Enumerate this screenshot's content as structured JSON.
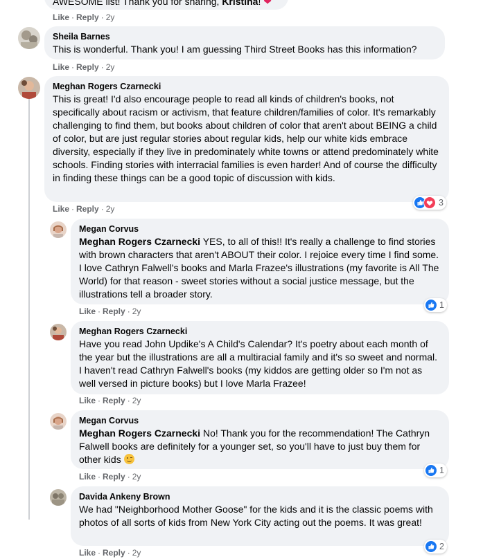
{
  "comments": [
    {
      "partial_text_prefix": "AWESOME list! Thank you for sharing, ",
      "partial_mention": "Kristina",
      "partial_text_suffix": "! ",
      "emoji": "red-heart",
      "like": "Like",
      "reply": "Reply",
      "time": "2y"
    },
    {
      "author": "Sheila Barnes",
      "text": "This is wonderful. Thank you! I am guessing Third Street Books has this information?",
      "like": "Like",
      "reply": "Reply",
      "time": "2y"
    },
    {
      "author": "Meghan Rogers Czarnecki",
      "text": "This is great! I'd also encourage people to read all kinds of children's books, not specifically about racism or activism, that feature children/families of color. It's remarkably challenging to find them, but books about children of color that aren't about BEING a child of color, but are just regular stories about regular kids, help our white kids embrace diversity, especially if they live in predominately white towns or attend predominately white schools. Finding stories with interracial families is even harder! And of course the difficulty in finding these things can be a good topic of discussion with kids.",
      "like": "Like",
      "reply": "Reply",
      "time": "2y",
      "reactions": [
        "like",
        "love"
      ],
      "reaction_count": "3"
    },
    {
      "author": "Megan Corvus",
      "mention": "Meghan Rogers Czarnecki",
      "text": " YES, to all of this!! It's really a challenge to find stories with brown characters that aren't ABOUT their color. I rejoice every time I find some. I love Cathryn Falwell's books and Marla Frazee's illustrations (my favorite is All The World) for that reason - sweet stories without a social justice message, but the illustrations tell a broader story.",
      "like": "Like",
      "reply": "Reply",
      "time": "2y",
      "reactions": [
        "like"
      ],
      "reaction_count": "1"
    },
    {
      "author": "Meghan Rogers Czarnecki",
      "text": "Have you read John Updike's A Child's Calendar? It's poetry about each month of the year but the illustrations are all a multiracial family and it's so sweet and normal. I haven't read Cathryn Falwell's books (my kiddos are getting older so I'm not as well versed in picture books) but I love Marla Frazee!",
      "like": "Like",
      "reply": "Reply",
      "time": "2y"
    },
    {
      "author": "Megan Corvus",
      "mention": "Meghan Rogers Czarnecki",
      "text": " No! Thank you for the recommendation! The Cathryn Falwell books are definitely for a younger set, so you'll have to just buy them for other kids ",
      "emoji": "winking-face",
      "like": "Like",
      "reply": "Reply",
      "time": "2y",
      "reactions": [
        "like"
      ],
      "reaction_count": "1"
    },
    {
      "author": "Davida Ankeny Brown",
      "text": "We had \"Neighborhood Mother Goose\" for the kids and it is the classic poems with photos of all sorts of kids from New York City acting out the poems. It was great!",
      "like": "Like",
      "reply": "Reply",
      "time": "2y",
      "reactions": [
        "like"
      ],
      "reaction_count": "2"
    }
  ],
  "separator": "·",
  "colors": {
    "bubble": "#f0f2f5",
    "meta_text": "#65676b",
    "like_blue": "#1877f2",
    "love_red": "#f33e58",
    "thread_line": "#ced0d4"
  }
}
